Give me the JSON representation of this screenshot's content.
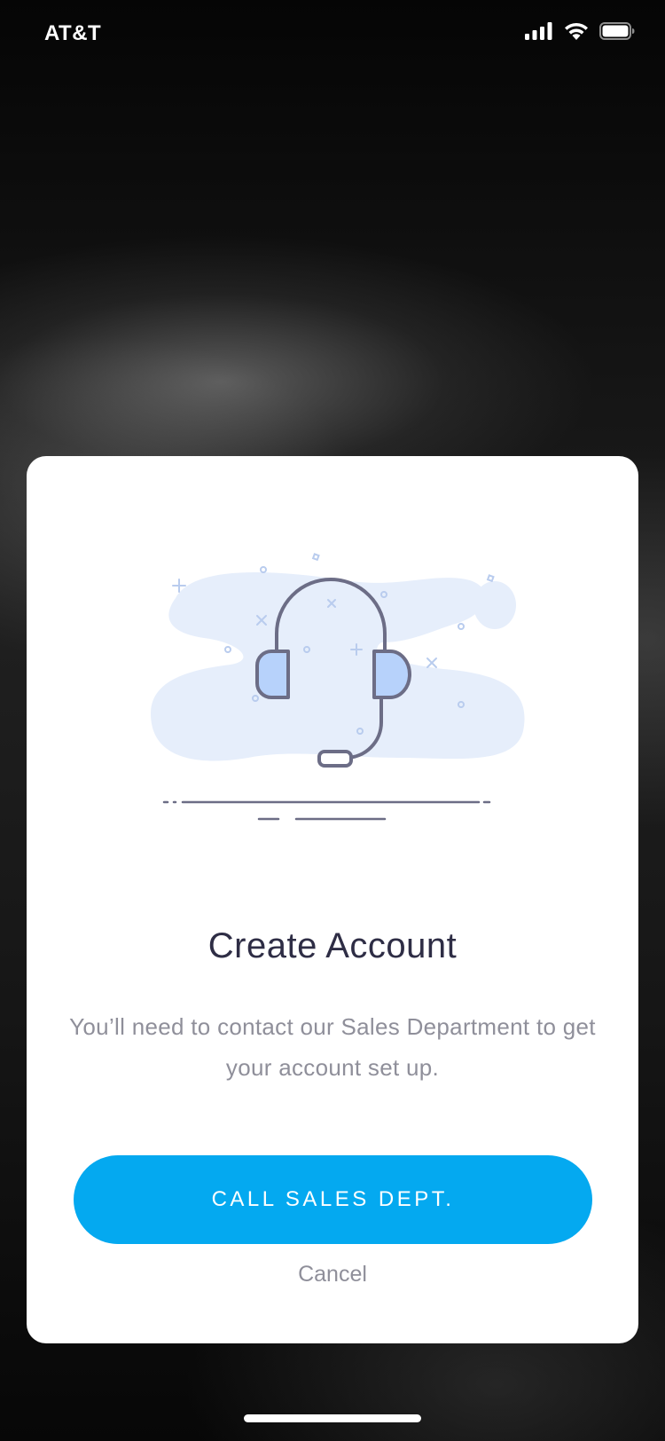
{
  "status_bar": {
    "carrier": "AT&T",
    "icons": [
      "cellular-signal-icon",
      "wifi-icon",
      "battery-icon"
    ]
  },
  "modal": {
    "illustration_icon": "headset-icon",
    "title": "Create Account",
    "message": "You’ll need to contact our Sales Department to get your account set up.",
    "primary_button_label": "CALL SALES DEPT.",
    "cancel_label": "Cancel"
  },
  "colors": {
    "accent": "#04A9F0",
    "title_text": "#2E2D45",
    "body_text": "#8F8F9A",
    "illustration_blob": "#E6EEFB",
    "illustration_stroke": "#6C6D86",
    "illustration_fill": "#B7D2FB"
  }
}
